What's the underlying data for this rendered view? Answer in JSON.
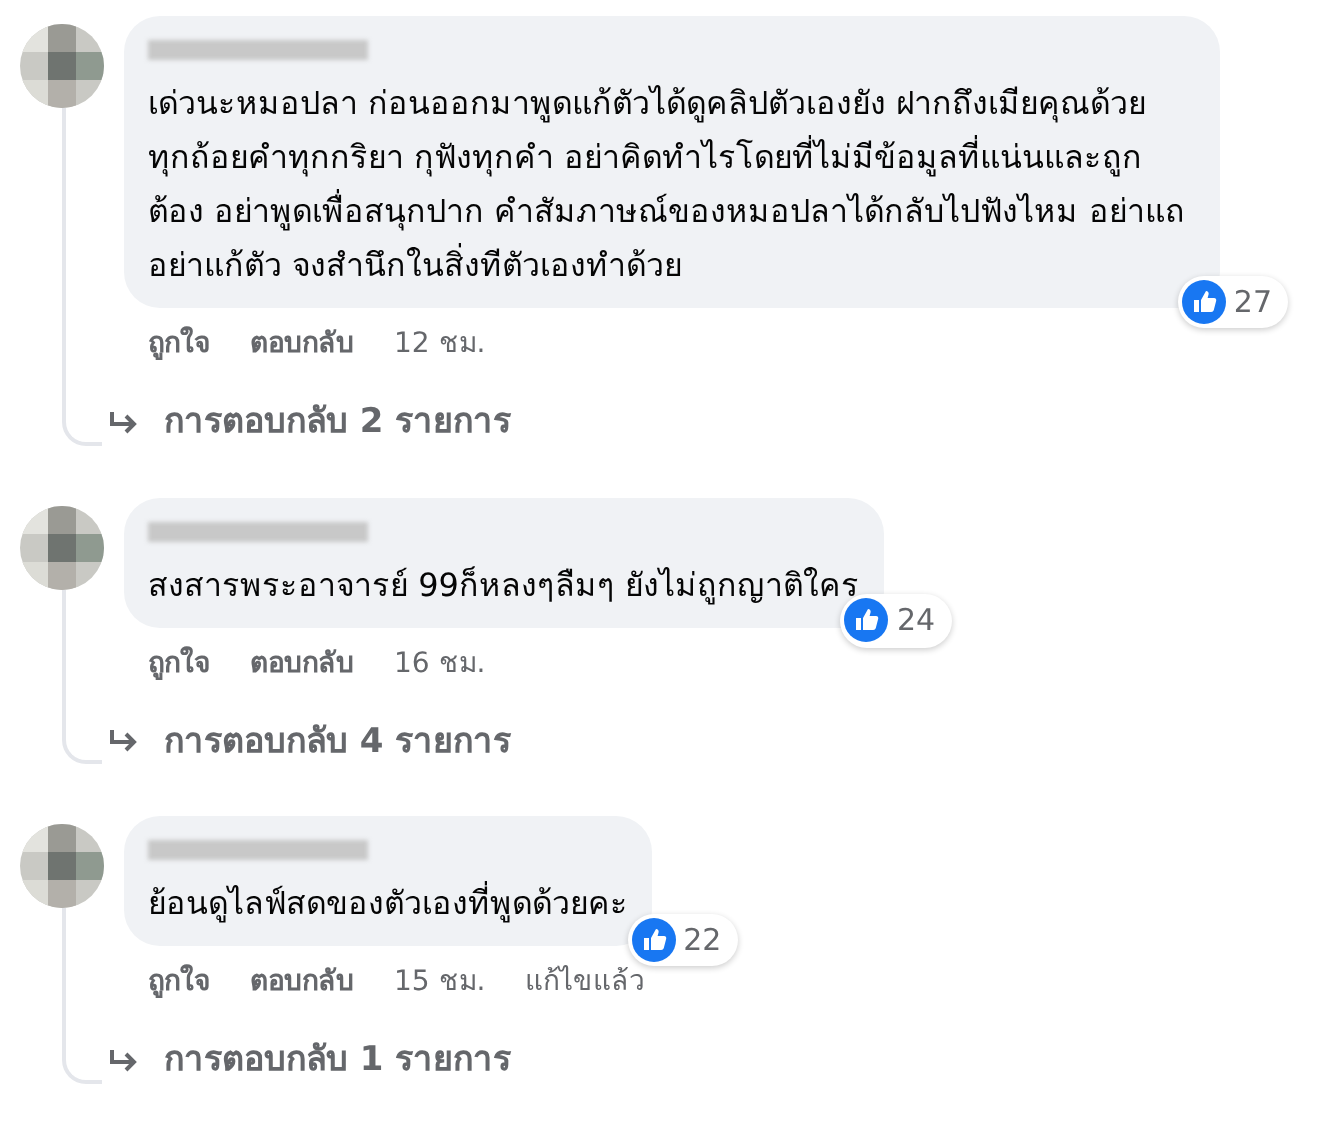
{
  "comments": [
    {
      "text": "เด่วนะหมอปลา ก่อนออกมาพูดแก้ตัวได้ดูคลิปตัวเองยัง ฝากถึงเมียคุณด้วย ทุกถ้อยคำทุกกริยา กุฟังทุกคำ อย่าคิดทำไรโดยที่ไม่มีข้อมูลที่แน่นและถูกต้อง อย่าพูดเพื่อสนุกปาก คำสัมภาษณ์ของหมอปลาได้กลับไปฟังไหม อย่าแถ อย่าแก้ตัว จงสำนึกในสิ่งทีตัวเองทำด้วย",
      "reactions": "27",
      "like": "ถูกใจ",
      "reply": "ตอบกลับ",
      "time": "12 ชม.",
      "replies": "การตอบกลับ 2 รายการ"
    },
    {
      "text": "สงสารพระอาจารย์ 99ก็หลงๆลืมๆ ยังไม่ถูกญาติใคร",
      "reactions": "24",
      "like": "ถูกใจ",
      "reply": "ตอบกลับ",
      "time": "16 ชม.",
      "replies": "การตอบกลับ 4 รายการ"
    },
    {
      "text": "ย้อนดูไลฟ์สดของตัวเองที่พูดด้วยคะ",
      "reactions": "22",
      "like": "ถูกใจ",
      "reply": "ตอบกลับ",
      "time": "15 ชม.",
      "edited": "แก้ไขแล้ว",
      "replies": "การตอบกลับ 1 รายการ"
    }
  ]
}
